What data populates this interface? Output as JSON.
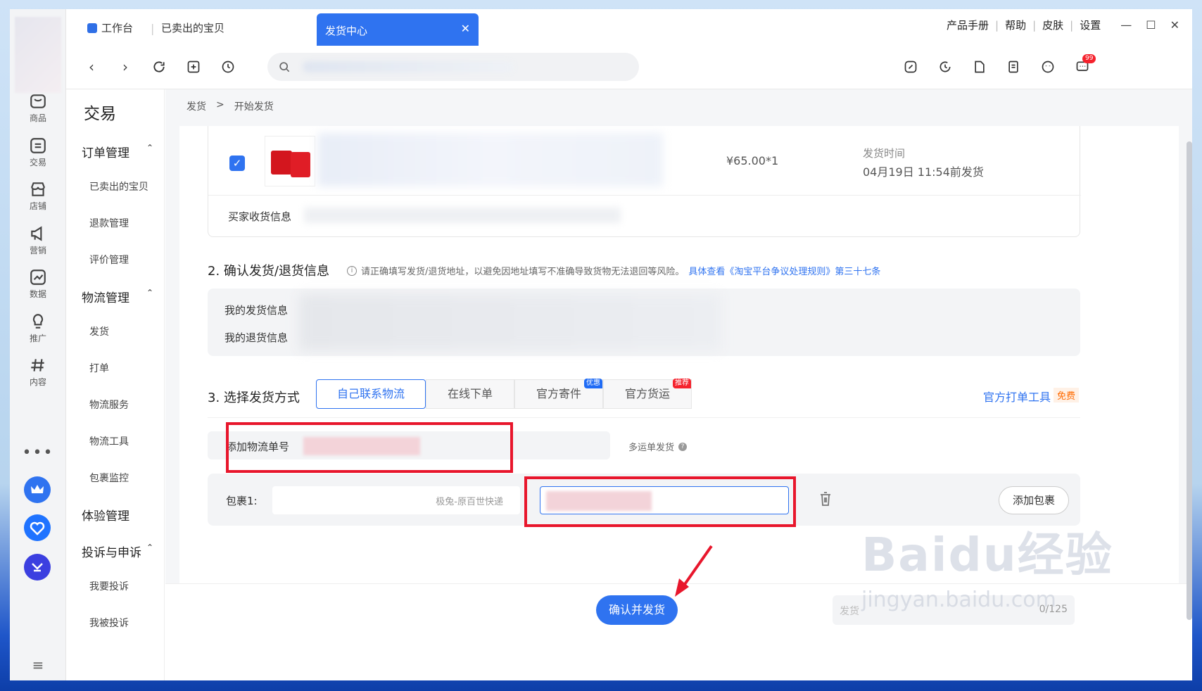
{
  "tabs": {
    "workspace": "工作台",
    "sold": "已卖出的宝贝",
    "active": "发货中心",
    "close": "✕"
  },
  "topright": {
    "manual": "产品手册",
    "help": "帮助",
    "skin": "皮肤",
    "settings": "设置",
    "sep": "|"
  },
  "toolbar": {
    "notif_count": "99"
  },
  "rail": {
    "items": [
      {
        "label": "商品",
        "icon": "bag-icon"
      },
      {
        "label": "交易",
        "icon": "list-icon"
      },
      {
        "label": "店铺",
        "icon": "store-icon"
      },
      {
        "label": "营销",
        "icon": "megaphone-icon"
      },
      {
        "label": "数据",
        "icon": "chart-icon"
      },
      {
        "label": "推广",
        "icon": "bulb-icon"
      },
      {
        "label": "内容",
        "icon": "hash-icon"
      }
    ],
    "more": "•••",
    "menu": "≡"
  },
  "sidenav": {
    "title": "交易",
    "groups": {
      "order": "订单管理",
      "logistics": "物流管理",
      "experience": "体验管理",
      "complaint": "投诉与申诉"
    },
    "items": {
      "sold": "已卖出的宝贝",
      "refund": "退款管理",
      "review": "评价管理",
      "ship": "发货",
      "print": "打单",
      "service": "物流服务",
      "tools": "物流工具",
      "monitor": "包裹监控",
      "complain": "我要投诉",
      "complained": "我被投诉"
    },
    "caret": "⌃"
  },
  "breadcrumb": {
    "level1": "发货",
    "sep": ">",
    "level2": "开始发货"
  },
  "order": {
    "price": "¥65.00*1",
    "ship_time_label": "发货时间",
    "ship_time_value": "04月19日 11:54前发货",
    "buyer_label": "买家收货信息"
  },
  "section2": {
    "title": "2. 确认发货/退货信息",
    "note": "请正确填写发货/退货地址，以避免因地址填写不准确导致货物无法退回等风险。",
    "link": "具体查看《淘宝平台争议处理规则》第三十七条",
    "send_label": "我的发货信息",
    "return_label": "我的退货信息"
  },
  "section3": {
    "title": "3. 选择发货方式",
    "methods": [
      "自己联系物流",
      "在线下单",
      "官方寄件",
      "官方货运"
    ],
    "tag_discount": "优惠",
    "tag_recommend": "推荐",
    "tool_link": "官方打单工具",
    "free": "免费",
    "add_tracking": "添加物流单号",
    "multi": "多运单发货",
    "package_label": "包裹1:",
    "courier": "极兔-原百世快递",
    "add_package": "添加包裹"
  },
  "footer": {
    "confirm": "确认并发货",
    "remark_counter": "0/125"
  },
  "watermark": {
    "brand": "Baidu经验",
    "url": "jingyan.baidu.com"
  },
  "colors": {
    "accent": "#2f73f0",
    "annotation": "#e8162c"
  }
}
